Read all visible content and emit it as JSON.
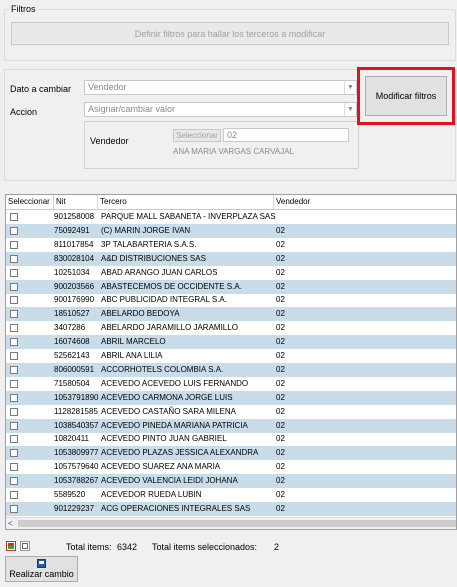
{
  "filtros": {
    "title": "Filtros",
    "define_button": "Definir filtros para hallar los terceros a modificar"
  },
  "form": {
    "dato_label": "Dato a cambiar",
    "dato_value": "Vendedor",
    "accion_label": "Accion",
    "accion_value": "Asignar/cambiar valor",
    "vendedor_label": "Vendedor",
    "seleccionar_button": "Seleccionar",
    "vendedor_code": "02",
    "vendedor_name": "ANA MARIA VARGAS CARVAJAL",
    "modificar_button": "Modificar filtros"
  },
  "grid": {
    "headers": [
      "Seleccionar",
      "Nit",
      "Tercero",
      "Vendedor"
    ],
    "rows": [
      {
        "nit": "901258008",
        "tercero": "PARQUE MALL SABANETA - INVERPLAZA SAS",
        "vendedor": ""
      },
      {
        "nit": "75092491",
        "tercero": "(C) MARIN JORGE IVAN",
        "vendedor": "02"
      },
      {
        "nit": "811017854",
        "tercero": "3P TALABARTERIA S.A.S.",
        "vendedor": "02"
      },
      {
        "nit": "830028104",
        "tercero": "A&D DISTRIBUCIONES SAS",
        "vendedor": "02"
      },
      {
        "nit": "10251034",
        "tercero": "ABAD ARANGO JUAN CARLOS",
        "vendedor": "02"
      },
      {
        "nit": "900203566",
        "tercero": "ABASTECEMOS DE OCCIDENTE S.A.",
        "vendedor": "02"
      },
      {
        "nit": "900176990",
        "tercero": "ABC PUBLICIDAD INTEGRAL S.A.",
        "vendedor": "02"
      },
      {
        "nit": "18510527",
        "tercero": "ABELARDO  BEDOYA",
        "vendedor": "02"
      },
      {
        "nit": "3407286",
        "tercero": "ABELARDO JARAMILLO JARAMILLO",
        "vendedor": "02"
      },
      {
        "nit": "16074608",
        "tercero": "ABRIL  MARCELO",
        "vendedor": "02"
      },
      {
        "nit": "52562143",
        "tercero": "ABRIL ANA LILIA",
        "vendedor": "02"
      },
      {
        "nit": "806000591",
        "tercero": "ACCORHOTELS COLOMBIA S.A.",
        "vendedor": "02"
      },
      {
        "nit": "71580504",
        "tercero": "ACEVEDO ACEVEDO LUIS FERNANDO",
        "vendedor": "02"
      },
      {
        "nit": "1053791890",
        "tercero": "ACEVEDO CARMONA JORGE LUIS",
        "vendedor": "02"
      },
      {
        "nit": "1128281585",
        "tercero": "ACEVEDO CASTAÑO SARA MILENA",
        "vendedor": "02"
      },
      {
        "nit": "1038540357",
        "tercero": "ACEVEDO PINEDA MARIANA PATRICIA",
        "vendedor": "02"
      },
      {
        "nit": "10820411",
        "tercero": "ACEVEDO PINTO JUAN GABRIEL",
        "vendedor": "02"
      },
      {
        "nit": "1053809977",
        "tercero": "ACEVEDO PLAZAS JESSICA ALEXANDRA",
        "vendedor": "02"
      },
      {
        "nit": "1057579640",
        "tercero": "ACEVEDO SUAREZ ANA MARIA",
        "vendedor": "02"
      },
      {
        "nit": "1053788267",
        "tercero": "ACEVEDO VALENCIA LEIDI JOHANA",
        "vendedor": "02"
      },
      {
        "nit": "5589520",
        "tercero": "ACEVEDOR RUEDA LUBIN",
        "vendedor": "02"
      },
      {
        "nit": "901229237",
        "tercero": "ACG OPERACIONES INTEGRALES SAS",
        "vendedor": "02"
      }
    ]
  },
  "footer": {
    "total_items_label": "Total items:",
    "total_items_value": "6342",
    "total_sel_label": "Total items seleccionados:",
    "total_sel_value": "2",
    "realizar_button": "Realizar cambio"
  },
  "icons": [
    "excel-icon",
    "grid-icon",
    "save-icon",
    "combo-arrow-icon"
  ],
  "colors": {
    "row_alt": "#c8dcea",
    "highlight": "#e0121d"
  }
}
